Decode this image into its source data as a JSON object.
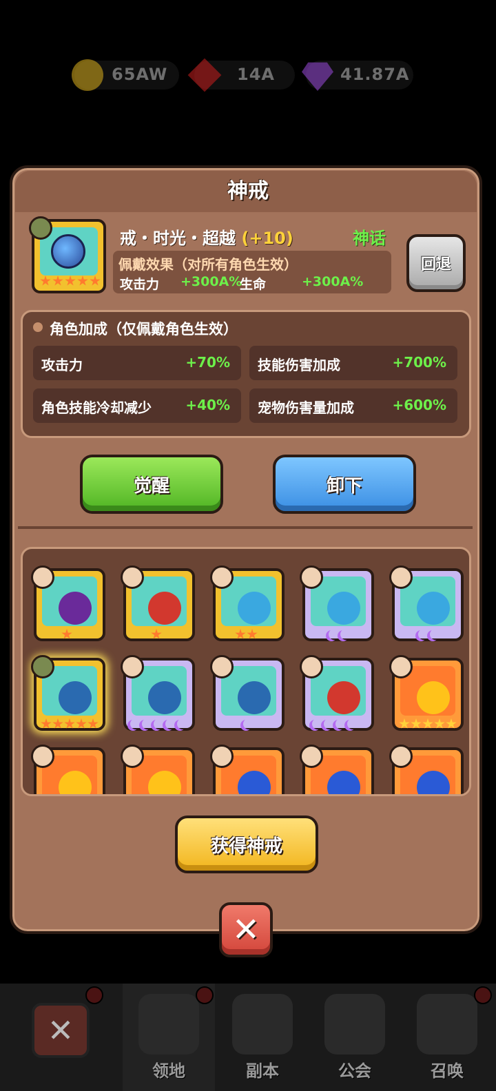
{
  "currency": [
    {
      "icon": "coin-icon",
      "value": "65AW"
    },
    {
      "icon": "ruby-icon",
      "value": "14A"
    },
    {
      "icon": "diamond-icon",
      "value": "41.87A"
    }
  ],
  "panel": {
    "title": "神戒",
    "ring": {
      "name": "戒・时光・超越",
      "level": "(+10)",
      "rarity": "神话",
      "effect_title": "佩戴效果（对所有角色生效）",
      "effects": [
        {
          "label": "攻击力",
          "value": "+300A%"
        },
        {
          "label": "生命",
          "value": "+300A%"
        }
      ]
    },
    "back_label": "回退",
    "bonus": {
      "title": "角色加成（仅佩戴角色生效）",
      "items": [
        {
          "label": "攻击力",
          "value": "+70%"
        },
        {
          "label": "技能伤害加成",
          "value": "+700%"
        },
        {
          "label": "角色技能冷却减少",
          "value": "+40%"
        },
        {
          "label": "宠物伤害量加成",
          "value": "+600%"
        }
      ]
    },
    "awaken_label": "觉醒",
    "unequip_label": "卸下",
    "gain_label": "获得神戒",
    "close_label": "✕"
  },
  "nav": {
    "items": [
      {
        "label": ""
      },
      {
        "label": "领地"
      },
      {
        "label": "副本"
      },
      {
        "label": "公会"
      },
      {
        "label": "召唤"
      }
    ]
  },
  "colors": {
    "panel": "#a3735b",
    "green": "#6df04a",
    "gold": "#f2c12e"
  }
}
